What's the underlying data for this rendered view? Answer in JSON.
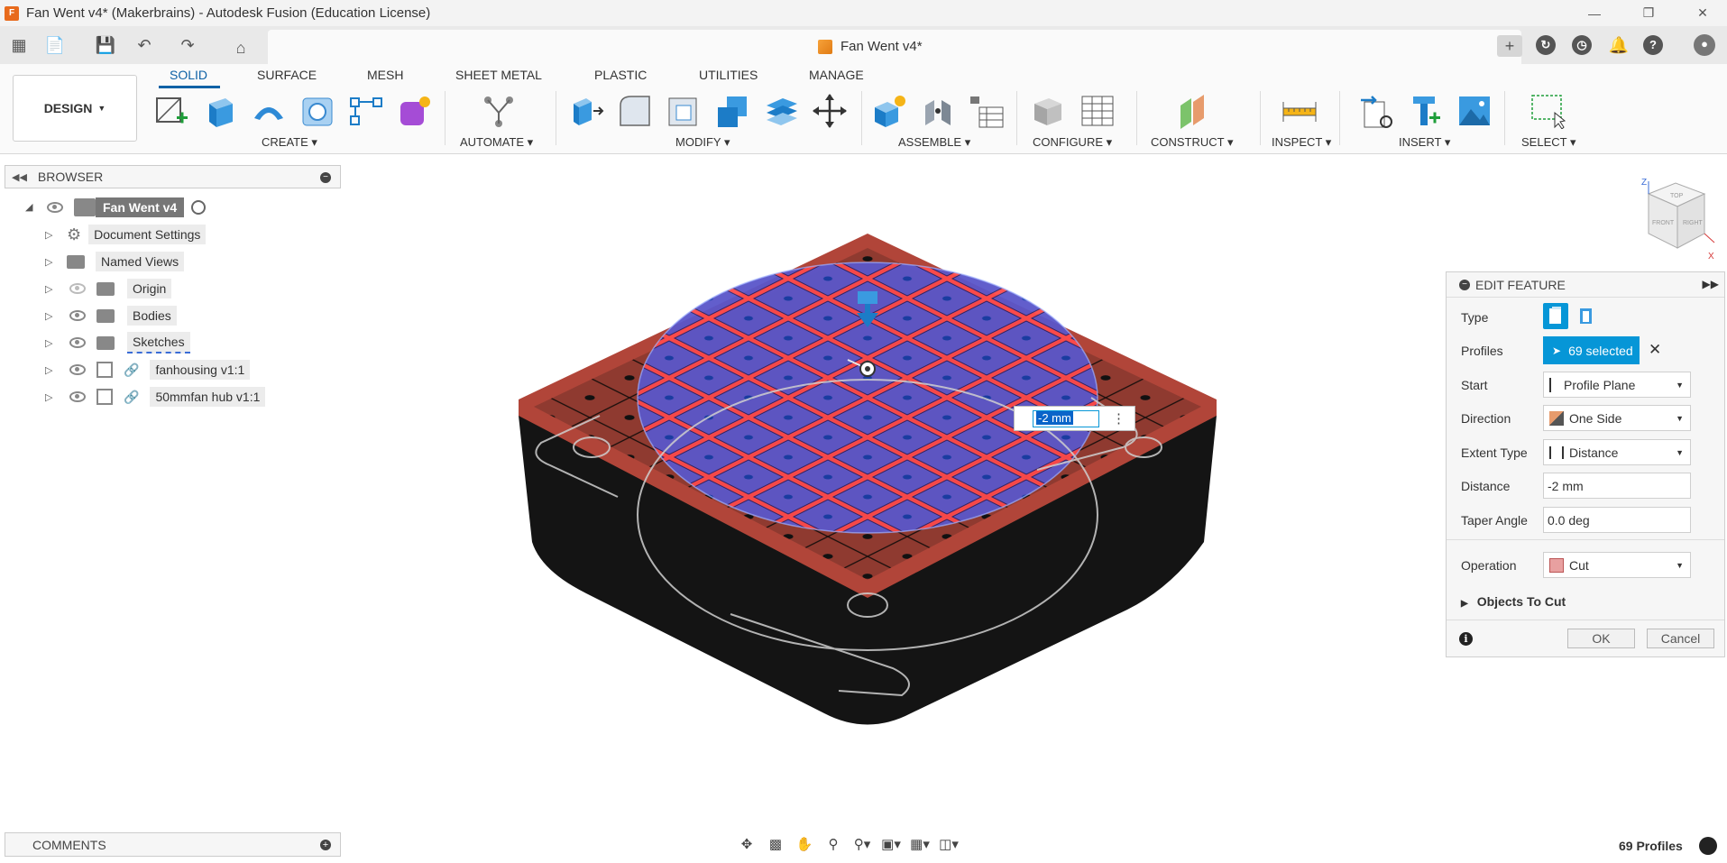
{
  "window": {
    "title": "Fan Went v4* (Makerbrains) - Autodesk Fusion (Education License)",
    "app_icon": "F"
  },
  "document_tab": {
    "label": "Fan Went v4*"
  },
  "ribbon": {
    "workspace": "DESIGN",
    "tabs": [
      "SOLID",
      "SURFACE",
      "MESH",
      "SHEET METAL",
      "PLASTIC",
      "UTILITIES",
      "MANAGE"
    ],
    "active_tab": "SOLID",
    "groups": [
      "CREATE",
      "AUTOMATE",
      "MODIFY",
      "ASSEMBLE",
      "CONFIGURE",
      "CONSTRUCT",
      "INSPECT",
      "INSERT",
      "SELECT"
    ]
  },
  "browser": {
    "title": "BROWSER",
    "root": "Fan Went v4",
    "items": [
      {
        "label": "Document Settings",
        "icon": "gear-icon"
      },
      {
        "label": "Named Views",
        "icon": "folder-icon"
      },
      {
        "label": "Origin",
        "icon": "folder-icon"
      },
      {
        "label": "Bodies",
        "icon": "folder-icon"
      },
      {
        "label": "Sketches",
        "icon": "folder-icon"
      },
      {
        "label": "fanhousing v1:1",
        "icon": "component-icon"
      },
      {
        "label": "50mmfan hub v1:1",
        "icon": "component-icon"
      }
    ]
  },
  "edit_feature": {
    "title": "EDIT FEATURE",
    "type_label": "Type",
    "profiles_label": "Profiles",
    "profiles_value": "69 selected",
    "start_label": "Start",
    "start_value": "Profile Plane",
    "direction_label": "Direction",
    "direction_value": "One Side",
    "extent_label": "Extent Type",
    "extent_value": "Distance",
    "distance_label": "Distance",
    "distance_value": "-2 mm",
    "taper_label": "Taper Angle",
    "taper_value": "0.0 deg",
    "operation_label": "Operation",
    "operation_value": "Cut",
    "objects_to_cut": "Objects To Cut",
    "ok": "OK",
    "cancel": "Cancel"
  },
  "dimension_input": {
    "value": "-2 mm"
  },
  "comments": {
    "title": "COMMENTS"
  },
  "status": {
    "text": "69 Profiles"
  },
  "viewcube": {
    "top": "TOP",
    "front": "FRONT",
    "right": "RIGHT",
    "z": "Z",
    "x": "X"
  },
  "colors": {
    "accent": "#0696d7",
    "body_top": "#b5473c",
    "body_side": "#141414",
    "selection": "#4b4fd0",
    "highlight": "#ff3a3a"
  }
}
